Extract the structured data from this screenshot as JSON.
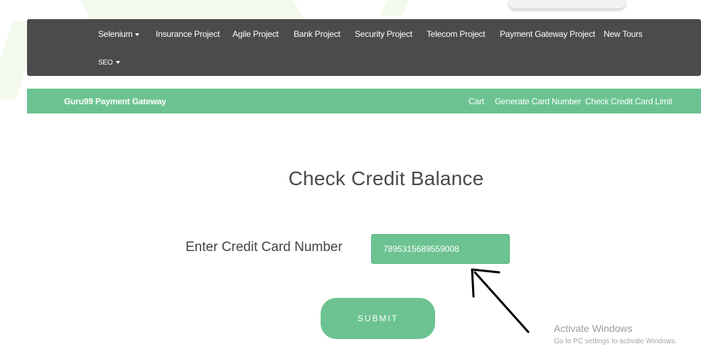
{
  "navbar": {
    "items": [
      {
        "label": "Selenium",
        "dropdown": true
      },
      {
        "label": "Insurance Project"
      },
      {
        "label": "Agile Project"
      },
      {
        "label": "Bank Project"
      },
      {
        "label": "Security Project"
      },
      {
        "label": "Telecom Project"
      },
      {
        "label": "Payment Gateway Project"
      },
      {
        "label": "New Tours"
      },
      {
        "label": "SEO",
        "dropdown": true
      }
    ]
  },
  "subnav": {
    "brand": "Guru99 Payment Gateway",
    "links": [
      "Cart",
      "Generate Card Number",
      "Check Credit Card Limit"
    ]
  },
  "main": {
    "title": "Check Credit Balance",
    "card_label": "Enter Credit Card Number",
    "card_value": "7895315689559008",
    "submit_label": "SUBMIT"
  },
  "watermark": {
    "title": "Activate Windows",
    "subtitle": "Go to PC settings to activate Windows."
  },
  "colors": {
    "navbar_bg": "#4b4b4b",
    "accent_green": "#6cc391",
    "text_dark": "#444444"
  }
}
